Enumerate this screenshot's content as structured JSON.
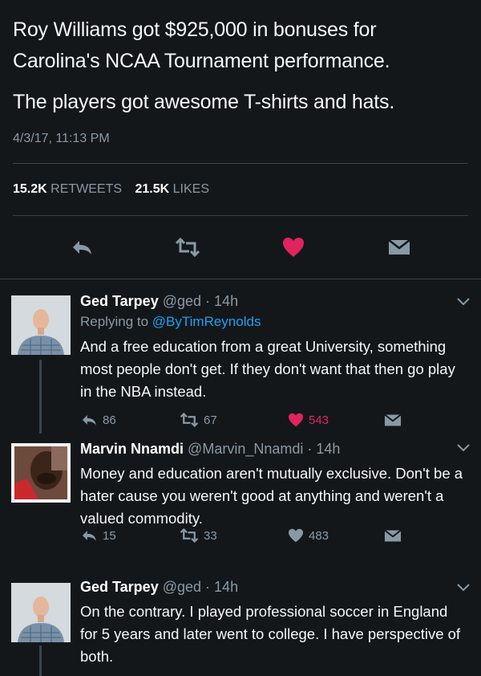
{
  "main_tweet": {
    "line1": "Roy Williams got $925,000 in bonuses for Carolina's NCAA Tournament performance.",
    "line2": "The players got awesome T-shirts and hats.",
    "timestamp": "4/3/17, 11:13 PM",
    "retweets_count": "15.2K",
    "retweets_label": "RETWEETS",
    "likes_count": "21.5K",
    "likes_label": "LIKES"
  },
  "replies": [
    {
      "name": "Ged Tarpey",
      "handle": "@ged",
      "time": "· 14h",
      "replying_prefix": "Replying to ",
      "replying_to": "@ByTimReynolds",
      "text": "And a free education from a great University, something most people don't get. If they don't want that then go play in the NBA instead.",
      "replies_count": "86",
      "retweets_count": "67",
      "likes_count": "543",
      "liked": true
    },
    {
      "name": "Marvin Nnamdi",
      "handle": "@Marvin_Nnamdi",
      "time": "· 14h",
      "text": "Money and education aren't mutually exclusive. Don't be a hater cause you weren't good at anything and weren't a valued commodity.",
      "replies_count": "15",
      "retweets_count": "33",
      "likes_count": "483",
      "liked": false
    },
    {
      "name": "Ged Tarpey",
      "handle": "@ged",
      "time": "· 14h",
      "text": "On the contrary. I played professional soccer in England for 5 years and later went to college. I have perspective of both."
    }
  ],
  "colors": {
    "background": "#14171a",
    "muted": "#8899a6",
    "link": "#1da1f2",
    "like": "#e0245e",
    "divider": "#38444d"
  }
}
